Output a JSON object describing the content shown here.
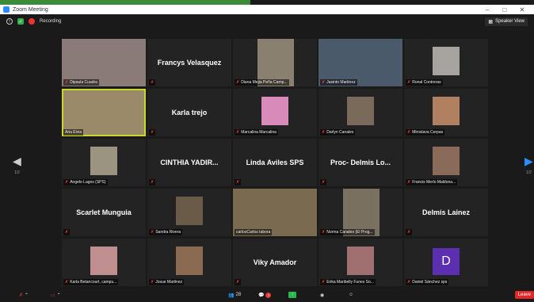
{
  "window": {
    "title": "Zoom Meeting"
  },
  "topbar": {
    "recording_label": "Recording",
    "speaker_view_label": "Speaker View"
  },
  "pager": {
    "left": "1/2",
    "right": "1/2"
  },
  "tiles": [
    {
      "name": "Dipaula Cuadra",
      "big": "",
      "kind": "photo"
    },
    {
      "name": "",
      "big": "Francys Velasquez",
      "kind": "name"
    },
    {
      "name": "Diana Mejia Peña Camp...",
      "big": "",
      "kind": "photo"
    },
    {
      "name": "Jasinto Martinez",
      "big": "",
      "kind": "photo"
    },
    {
      "name": "Ronal Contreras",
      "big": "",
      "kind": "photo"
    },
    {
      "name": "Aria Elvia",
      "big": "",
      "kind": "photo"
    },
    {
      "name": "",
      "big": "Karla trejo",
      "kind": "name"
    },
    {
      "name": "Marcalina Marcalina",
      "big": "",
      "kind": "photo"
    },
    {
      "name": "Darlyn Canales",
      "big": "",
      "kind": "photo"
    },
    {
      "name": "Miroslava Cerpas",
      "big": "",
      "kind": "photo"
    },
    {
      "name": "Angelo Lagos (SPS)",
      "big": "",
      "kind": "photo"
    },
    {
      "name": "",
      "big": "CINTHIA YADIR...",
      "kind": "name"
    },
    {
      "name": "",
      "big": "Linda Aviles SPS",
      "kind": "name"
    },
    {
      "name": "",
      "big": "Proc- Delmis Lo...",
      "kind": "name"
    },
    {
      "name": "Francis Merlo Maldona...",
      "big": "",
      "kind": "photo"
    },
    {
      "name": "",
      "big": "Scarlet Munguia",
      "kind": "name"
    },
    {
      "name": "Sandra Rivera",
      "big": "",
      "kind": "photo"
    },
    {
      "name": "carlosCarlos tabora",
      "big": "",
      "kind": "photo"
    },
    {
      "name": "Norma Canales (El Prog...",
      "big": "",
      "kind": "photo"
    },
    {
      "name": "",
      "big": "Delmis Lainez",
      "kind": "name"
    },
    {
      "name": "Karla Betancourt, campu...",
      "big": "",
      "kind": "photo"
    },
    {
      "name": "Josue Martinez",
      "big": "",
      "kind": "photo"
    },
    {
      "name": "",
      "big": "Viky Amador",
      "kind": "name"
    },
    {
      "name": "Erika Maribelly Funes So...",
      "big": "",
      "kind": "photo"
    },
    {
      "name": "Daniel Sánchez sps",
      "big": "",
      "kind": "avatar",
      "letter": "D"
    }
  ],
  "bottombar": {
    "participants_count": "28",
    "chat_badge": "2",
    "leave_label": "Leave"
  },
  "colors": {
    "active_border": "#c8d82a",
    "leave": "#e02828",
    "avatar_d": "#5c2fb0"
  }
}
